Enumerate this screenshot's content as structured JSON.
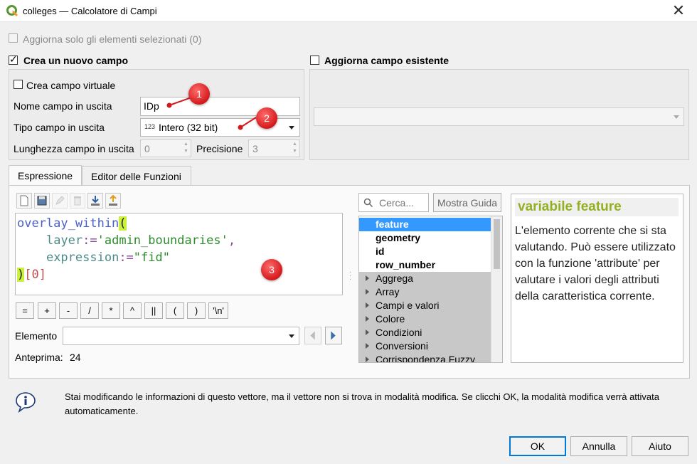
{
  "window": {
    "title": "colleges — Calcolatore di Campi"
  },
  "options": {
    "update_selected_label": "Aggiorna solo gli elementi selezionati (0)",
    "create_new_field_label": "Crea un nuovo campo",
    "update_existing_field_label": "Aggiorna campo esistente"
  },
  "new_field": {
    "virtual_label": "Crea campo virtuale",
    "name_label": "Nome campo in uscita",
    "name_value": "IDp",
    "type_label": "Tipo campo in uscita",
    "type_value": "Intero (32 bit)",
    "type_prefix": "123",
    "length_label": "Lunghezza campo in uscita",
    "length_value": "0",
    "precision_label": "Precisione",
    "precision_value": "3"
  },
  "tabs": [
    {
      "label": "Espressione",
      "active": true
    },
    {
      "label": "Editor delle Funzioni",
      "active": false
    }
  ],
  "editor": {
    "lines": [
      {
        "fn": "overlay_within",
        "paren": "("
      },
      {
        "indent": "    ",
        "arg": "layer",
        "op": ":=",
        "str": "'admin_boundaries'",
        "comma": ","
      },
      {
        "indent": "    ",
        "arg": "expression",
        "op": ":=",
        "str": "\"fid\""
      },
      {
        "paren": ")",
        "index": "[0]"
      }
    ]
  },
  "operators": [
    "=",
    "+",
    "-",
    "/",
    "*",
    "^",
    "||",
    "(",
    ")",
    "'\\n'"
  ],
  "element": {
    "label": "Elemento",
    "value": ""
  },
  "preview": {
    "label": "Anteprima:",
    "value": "24"
  },
  "search": {
    "placeholder": "Cerca..."
  },
  "show_help_label": "Mostra Guida",
  "function_tree": [
    {
      "label": "feature",
      "bold": true,
      "selected": true,
      "group": false
    },
    {
      "label": "geometry",
      "bold": true,
      "selected": false,
      "group": false
    },
    {
      "label": "id",
      "bold": true,
      "selected": false,
      "group": false
    },
    {
      "label": "row_number",
      "bold": true,
      "selected": false,
      "group": false
    },
    {
      "label": "Aggrega",
      "group": true
    },
    {
      "label": "Array",
      "group": true
    },
    {
      "label": "Campi e valori",
      "group": true
    },
    {
      "label": "Colore",
      "group": true
    },
    {
      "label": "Condizioni",
      "group": true
    },
    {
      "label": "Conversioni",
      "group": true
    },
    {
      "label": "Corrispondenza Fuzzy",
      "group": true
    }
  ],
  "help": {
    "title": "variabile feature",
    "body": "L'elemento corrente che si sta valutando. Può essere utilizzato con la funzione 'attribute' per valutare i valori degli attributi della caratteristica corrente."
  },
  "info_message": "Stai modificando le informazioni di questo vettore, ma il vettore non si trova in modalità modifica. Se clicchi OK, la modalità modifica verrà attivata automaticamente.",
  "buttons": {
    "ok": "OK",
    "cancel": "Annulla",
    "help": "Aiuto"
  },
  "markers": [
    "1",
    "2",
    "3"
  ],
  "colors": {
    "accent": "#0078d7",
    "help_title": "#93b023",
    "selection": "#3399ff",
    "marker": "#d4191c",
    "paren_highlight": "#c9f03b"
  }
}
